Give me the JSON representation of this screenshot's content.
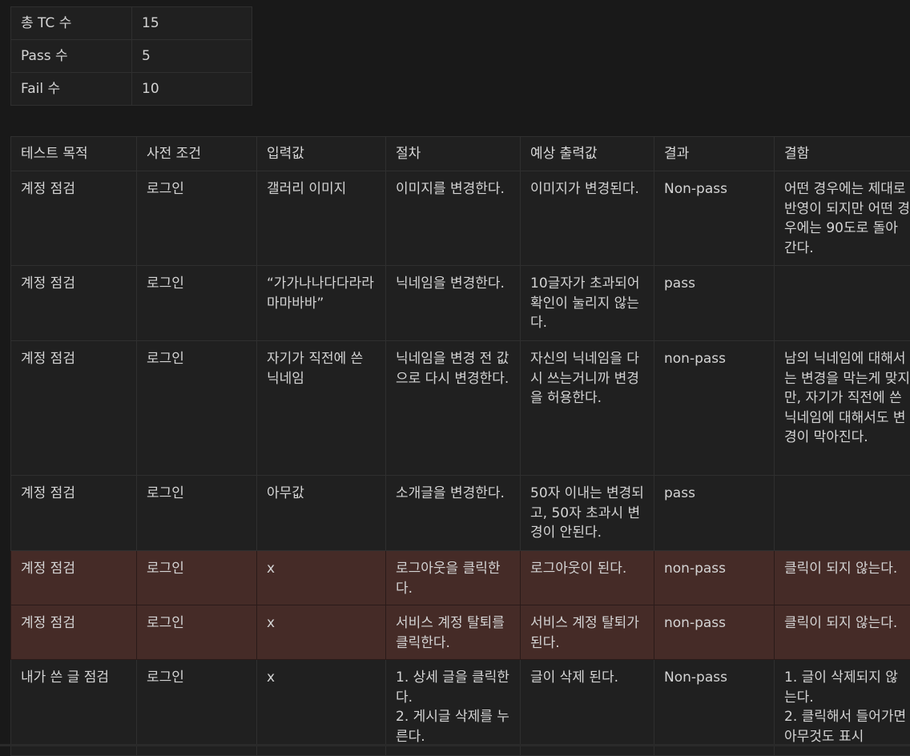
{
  "summary": [
    {
      "label": "총 TC 수",
      "value": "15"
    },
    {
      "label": "Pass 수",
      "value": "5"
    },
    {
      "label": "Fail 수",
      "value": "10"
    }
  ],
  "table": {
    "headers": [
      "테스트 목적",
      "사전 조건",
      "입력값",
      "절차",
      "예상 출력값",
      "결과",
      "결함"
    ],
    "rows": [
      {
        "purpose": "계정 점검",
        "precondition": "로그인",
        "input": "갤러리 이미지",
        "procedure": "이미지를 변경한다.",
        "expected": "이미지가 변경된다.",
        "result": "Non-pass",
        "defect": "어떤 경우에는 제대로 반영이 되지만 어떤 경우에는 90도로 돌아간다."
      },
      {
        "purpose": "계정 점검",
        "precondition": "로그인",
        "input": "“가가나나다다라라마마바바”",
        "procedure": "닉네임을 변경한다.",
        "expected": "10글자가 초과되어 확인이 눌리지 않는다.",
        "result": "pass",
        "defect": ""
      },
      {
        "purpose": "계정 점검",
        "precondition": "로그인",
        "input": "자기가 직전에 쓴 닉네임",
        "procedure": "닉네임을 변경 전 값으로 다시 변경한다.",
        "expected": "자신의 닉네임을 다시 쓰는거니까 변경을 허용한다.",
        "result": "non-pass",
        "defect": "남의 닉네임에 대해서는 변경을 막는게 맞지만, 자기가 직전에 쓴 닉네임에 대해서도 변경이 막아진다."
      },
      {
        "purpose": "계정 점검",
        "precondition": "로그인",
        "input": "아무값",
        "procedure": "소개글을 변경한다.",
        "expected": "50자 이내는 변경되고, 50자 초과시 변경이 안된다.",
        "result": "pass",
        "defect": ""
      },
      {
        "purpose": "계정 점검",
        "precondition": "로그인",
        "input": "x",
        "procedure": "로그아웃을 클릭한다.",
        "expected": "로그아웃이 된다.",
        "result": "non-pass",
        "defect": "클릭이 되지 않는다."
      },
      {
        "purpose": "계정 점검",
        "precondition": "로그인",
        "input": "x",
        "procedure": "서비스 계정 탈퇴를 클릭한다.",
        "expected": "서비스 계정 탈퇴가 된다.",
        "result": "non-pass",
        "defect": "클릭이 되지 않는다."
      },
      {
        "purpose": "내가 쓴 글 점검",
        "precondition": "로그인",
        "input": "x",
        "procedure": "1. 상세 글을 클릭한다.\n2. 게시글 삭제를 누른다.",
        "expected": "글이 삭제 된다.",
        "result": "Non-pass",
        "defect": "1. 글이 삭제되지 않는다.\n2. 클릭해서 들어가면 아무것도 표시"
      }
    ]
  }
}
